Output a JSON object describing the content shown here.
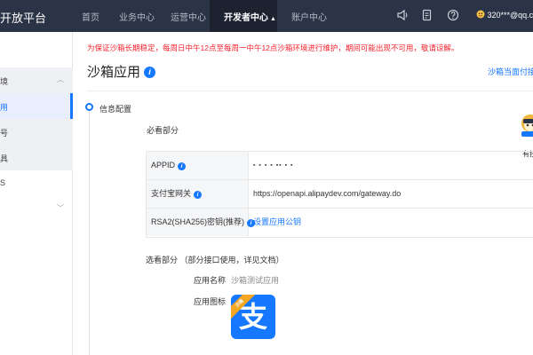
{
  "header": {
    "brand": "开放平台",
    "nav": [
      "首页",
      "业务中心",
      "运营中心",
      "开发者中心",
      "账户中心"
    ],
    "active_index": 3,
    "active_caret": "▲",
    "account": "320***@qq.co"
  },
  "sidebar": {
    "items": [
      {
        "label": "境",
        "group": true,
        "chevron": "︿"
      },
      {
        "label": "用",
        "active": true
      },
      {
        "label": "号"
      },
      {
        "label": "具",
        "group": true
      },
      {
        "label": "S"
      },
      {
        "label": "",
        "chevron": "﹀"
      }
    ]
  },
  "main": {
    "notice": "为保证沙箱长期稳定，每周日中午12点至每周一中午12点沙箱环境进行维护，期间可能出现不可用，敬请谅解。",
    "title": "沙箱应用",
    "info_glyph": "i",
    "top_link": "沙箱当面付接",
    "section_title": "信息配置",
    "mascot_label": "有技",
    "required": {
      "title": "必看部分",
      "rows": [
        {
          "key": "APPID",
          "value": "▪ ▪ ▪ ▪ ▪▪ ▪ ▪",
          "masked": true
        },
        {
          "key": "支付宝网关",
          "value": "https://openapi.alipaydev.com/gateway.do"
        },
        {
          "key": "RSA2(SHA256)密钥(推荐)",
          "value": "设置应用公钥",
          "link": true
        }
      ]
    },
    "optional": {
      "title": "选看部分 （部分接口使用，详见文档）",
      "app_name_label": "应用名称",
      "app_name_value": "沙箱测试应用",
      "app_icon_label": "应用图标",
      "icon_char": "支",
      "icon_ribbon": "沙箱"
    }
  },
  "colors": {
    "topbar": "#2b3446",
    "accent": "#1677ff",
    "notice": "#f5222d",
    "alipay_blue": "#1677ff",
    "ribbon": "#f5a623"
  }
}
